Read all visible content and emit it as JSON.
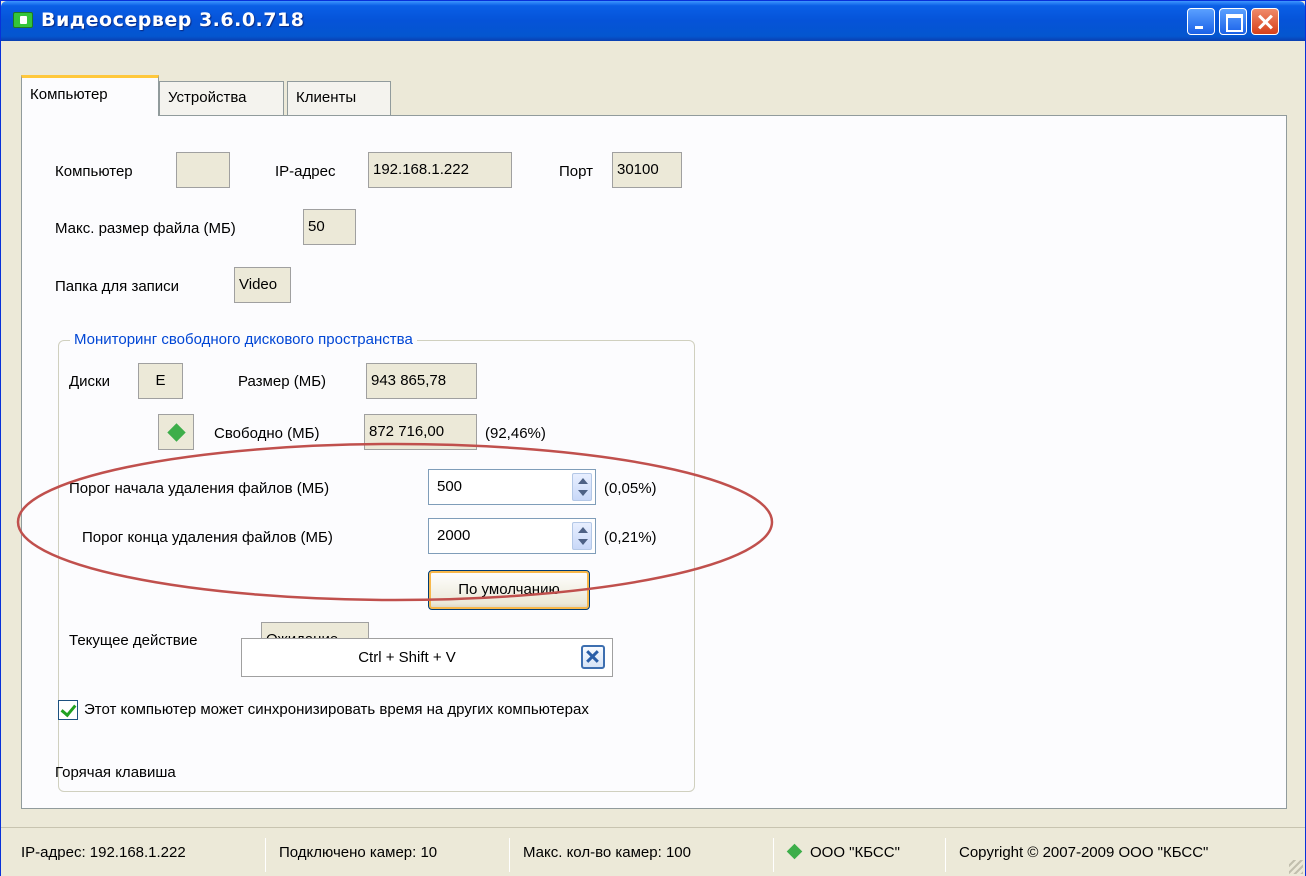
{
  "window": {
    "title": "Видеосервер 3.6.0.718"
  },
  "tabs": [
    {
      "label": "Компьютер",
      "active": true
    },
    {
      "label": "Устройства",
      "active": false
    },
    {
      "label": "Клиенты",
      "active": false
    }
  ],
  "computer": {
    "computer_label": "Компьютер",
    "computer_value": "",
    "ip_label": "IP-адрес",
    "ip_value": "192.168.1.222",
    "port_label": "Порт",
    "port_value": "30100",
    "max_file_label": "Макс. размер файла (МБ)",
    "max_file_value": "50",
    "record_folder_label": "Папка для записи",
    "record_folder_value": "Video"
  },
  "monitoring": {
    "title": "Мониторинг свободного дискового пространства",
    "disks_label": "Диски",
    "disks_value": "E",
    "size_label": "Размер (МБ)",
    "size_value": "943 865,78",
    "free_label": "Свободно (МБ)",
    "free_value": "872 716,00",
    "free_percent": "(92,46%)",
    "start_threshold_label": "Порог начала удаления файлов (МБ)",
    "start_threshold_value": "500",
    "start_threshold_percent": "(0,05%)",
    "end_threshold_label": "Порог конца удаления файлов (МБ)",
    "end_threshold_value": "2000",
    "end_threshold_percent": "(0,21%)",
    "default_button": "По умолчанию",
    "current_action_label": "Текущее действие",
    "current_action_value": "Ожидание"
  },
  "sync": {
    "label": "Этот компьютер может синхронизировать время на других компьютерах",
    "checked": true
  },
  "hotkey": {
    "label": "Горячая клавиша",
    "value": "Ctrl + Shift + V"
  },
  "statusbar": {
    "ip": "IP-адрес: 192.168.1.222",
    "connected": "Подключено камер: 10",
    "max_cameras": "Макс. кол-во камер: 100",
    "company": "ООО \"КБСС\"",
    "copyright": "Copyright © 2007-2009 ООО \"КБСС\""
  },
  "colors": {
    "annotation_ellipse": "#c0504d",
    "group_title": "#0046d5",
    "status_diamond": "#3dae4a"
  },
  "icons": {
    "app": "video-camera-icon",
    "status": "green-diamond-icon",
    "clear": "clear-x-icon"
  }
}
